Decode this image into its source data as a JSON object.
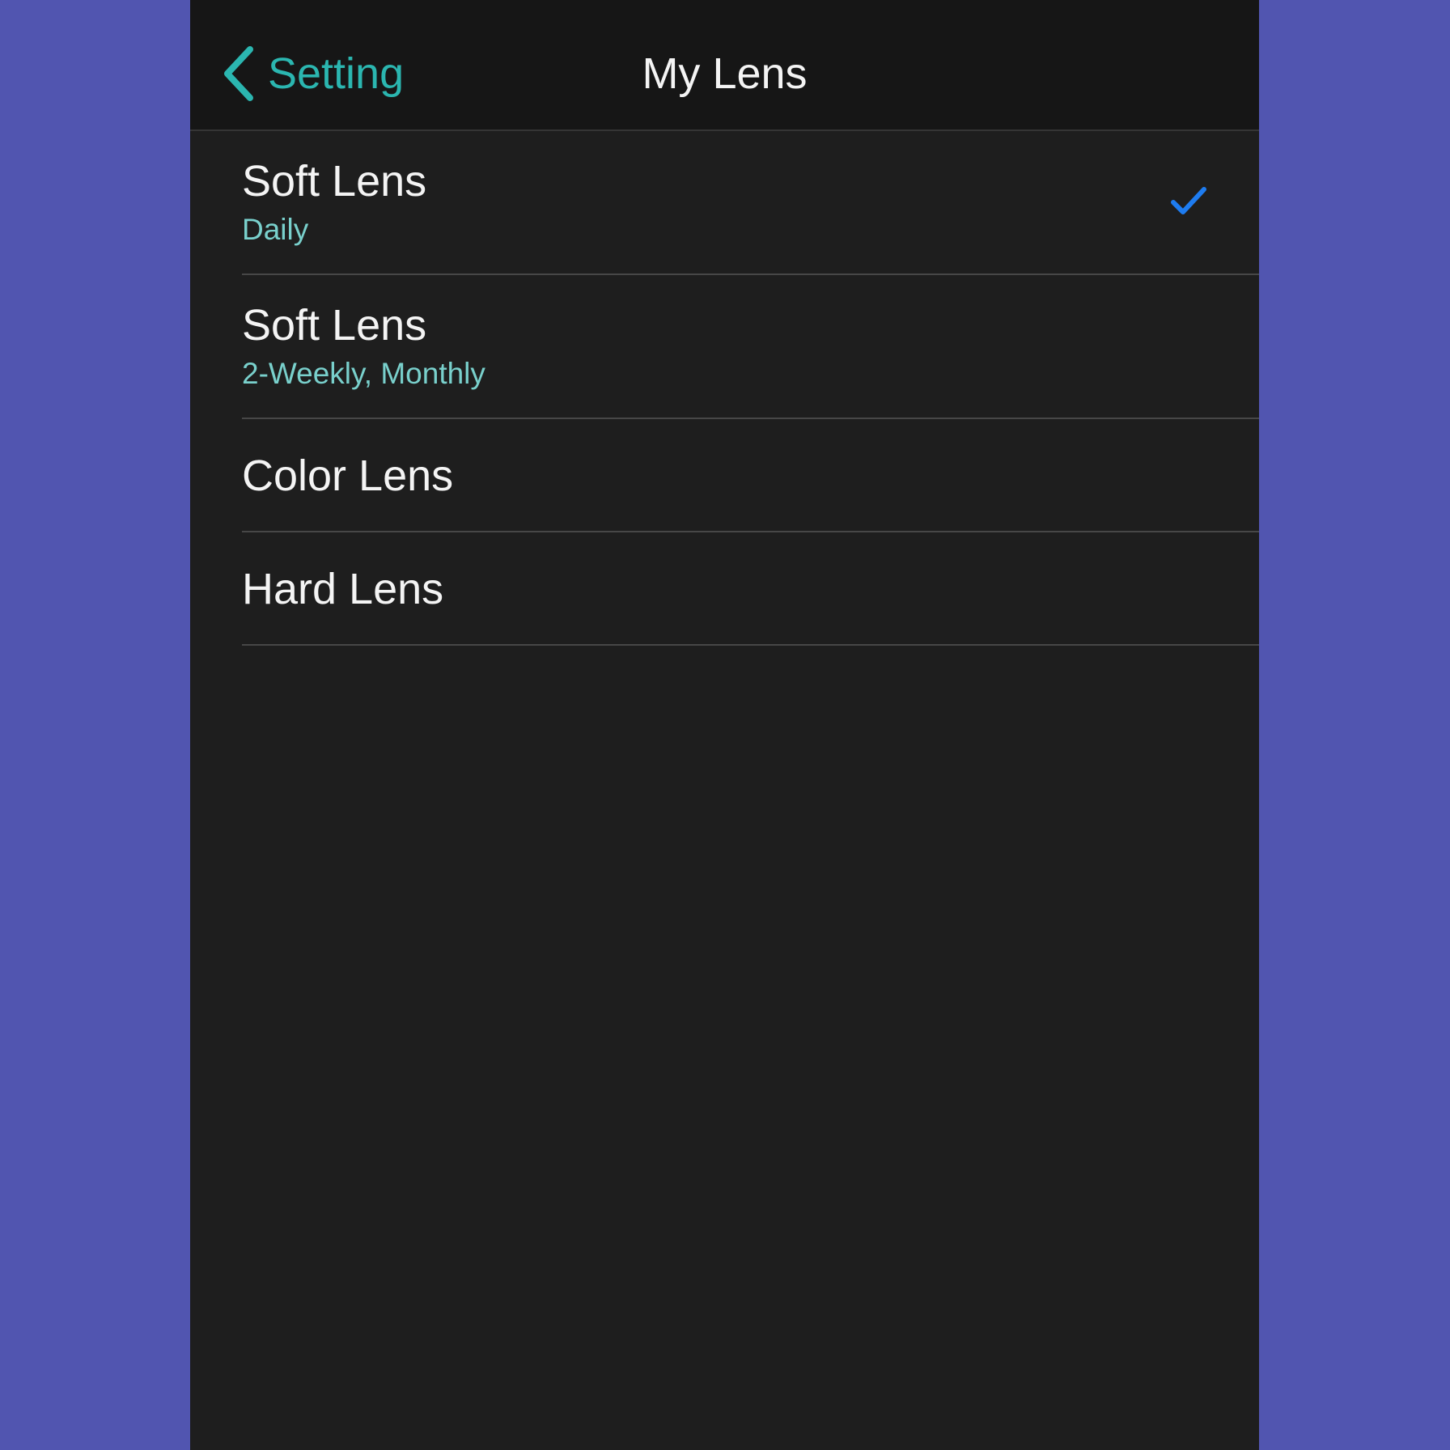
{
  "colors": {
    "accent": "#2bb6b0",
    "subtitle": "#79d0cc",
    "check": "#1e7cf0"
  },
  "navbar": {
    "back_icon": "chevron-left-icon",
    "back_label": "Setting",
    "title": "My Lens"
  },
  "lens_list": {
    "items": [
      {
        "title": "Soft Lens",
        "subtitle": "Daily",
        "selected": true
      },
      {
        "title": "Soft Lens",
        "subtitle": "2-Weekly, Monthly",
        "selected": false
      },
      {
        "title": "Color Lens",
        "subtitle": "",
        "selected": false
      },
      {
        "title": "Hard Lens",
        "subtitle": "",
        "selected": false
      }
    ],
    "selected_icon": "checkmark-icon"
  }
}
